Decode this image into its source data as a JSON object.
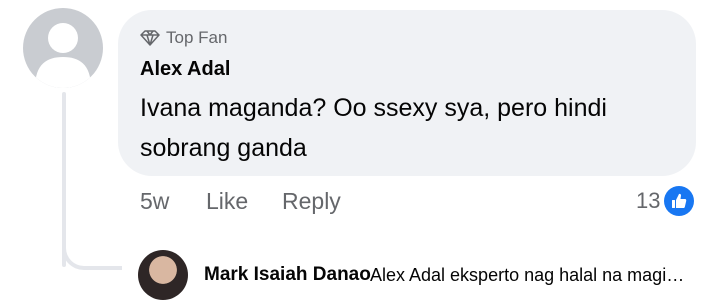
{
  "comment": {
    "badge_label": "Top Fan",
    "badge_icon": "diamond-icon",
    "author": "Alex Adal",
    "text": "Ivana maganda? Oo ssexy sya, pero hindi sobrang ganda",
    "age": "5w",
    "like_label": "Like",
    "reply_label": "Reply",
    "like_count": "13",
    "accent_color": "#1877f2"
  },
  "reply_preview": {
    "author": "Mark Isaiah Danao",
    "text": "Alex Adal eksperto nag halal na magin..."
  }
}
